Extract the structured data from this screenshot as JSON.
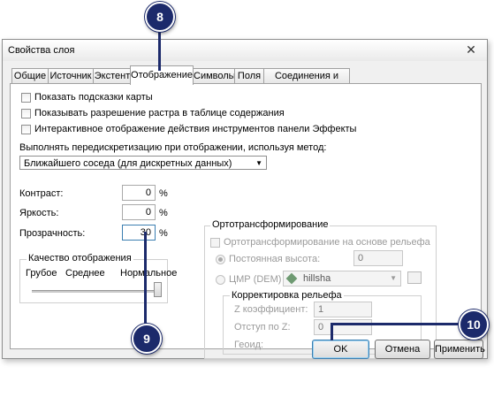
{
  "window": {
    "title": "Свойства слоя",
    "close_glyph": "✕"
  },
  "tabs": [
    {
      "label": "Общие"
    },
    {
      "label": "Источник"
    },
    {
      "label": "Экстент"
    },
    {
      "label": "Отображение"
    },
    {
      "label": "Символы"
    },
    {
      "label": "Поля"
    },
    {
      "label": "Соединения и Связи"
    }
  ],
  "display": {
    "checkboxes": [
      {
        "label": "Показать подсказки карты"
      },
      {
        "label": "Показывать разрешение растра в таблице содержания"
      },
      {
        "label": "Интерактивное отображение действия инструментов панели Эффекты"
      }
    ],
    "resample_label": "Выполнять передискретизацию при отображении, используя метод:",
    "resample_value": "Ближайшего соседа (для дискретных данных)",
    "contrast_label": "Контраст:",
    "contrast_value": "0",
    "brightness_label": "Яркость:",
    "brightness_value": "0",
    "transparency_label": "Прозрачность:",
    "transparency_value": "30",
    "percent": "%",
    "quality": {
      "title": "Качество отображения",
      "low": "Грубое",
      "medium": "Среднее",
      "high": "Нормальное"
    },
    "ortho": {
      "title": "Ортотрансформирование",
      "checkbox_label": "Ортотрансформирование на основе рельефа",
      "const_height_label": "Постоянная высота:",
      "const_height_value": "0",
      "dem_label": "ЦМР (DEM)",
      "dem_value": "hillsha",
      "correction": {
        "title": "Корректировка рельефа",
        "z_factor_label": "Z коэффициент:",
        "z_factor_value": "1",
        "z_offset_label": "Отступ по Z:",
        "z_offset_value": "0",
        "geoid_label": "Геоид:"
      }
    }
  },
  "buttons": {
    "ok": "OK",
    "cancel": "Отмена",
    "apply": "Применить"
  },
  "callouts": {
    "tab": "8",
    "transparency": "9",
    "ok": "10"
  }
}
